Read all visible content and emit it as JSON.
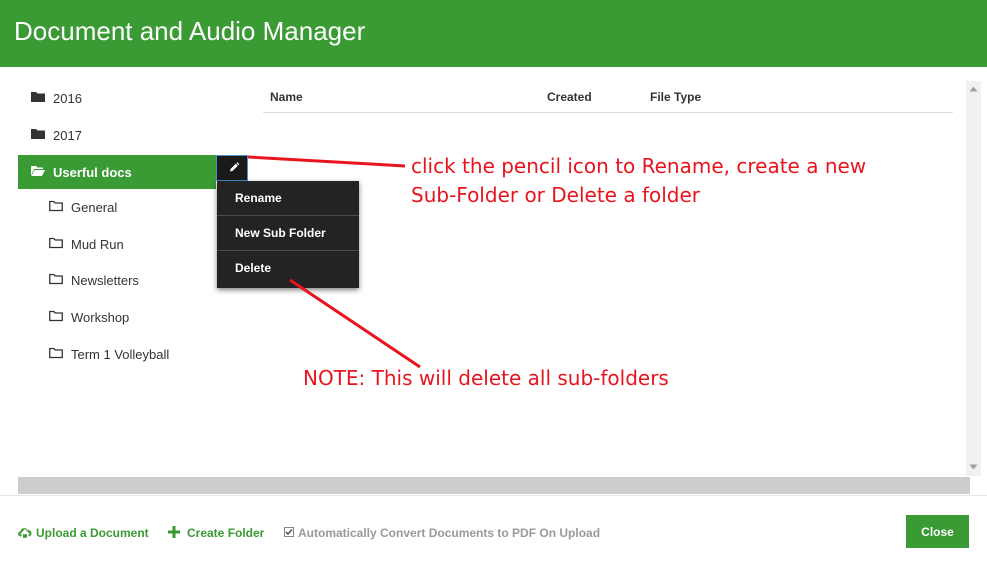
{
  "window": {
    "title": "Document and Audio Manager"
  },
  "folders": [
    {
      "label": "2016",
      "icon": "folder-icon"
    },
    {
      "label": "2017",
      "icon": "folder-icon"
    },
    {
      "label": "Userful docs",
      "icon": "folder-open-icon",
      "selected": true
    },
    {
      "label": "General",
      "icon": "folder-outline-icon"
    },
    {
      "label": "Mud Run",
      "icon": "folder-outline-icon"
    },
    {
      "label": "Newsletters",
      "icon": "folder-outline-icon"
    },
    {
      "label": "Workshop",
      "icon": "folder-outline-icon"
    },
    {
      "label": "Term 1 Volleyball",
      "icon": "folder-outline-icon"
    }
  ],
  "context_menu": {
    "trigger_icon": "pencil-icon",
    "items": [
      "Rename",
      "New Sub Folder",
      "Delete"
    ]
  },
  "table": {
    "columns": [
      "Name",
      "Created",
      "File Type"
    ]
  },
  "annotations": {
    "pencil_note_line1": "click the pencil icon to Rename, create a new",
    "pencil_note_line2": "Sub-Folder or Delete a folder",
    "delete_note": "NOTE: This will delete all sub-folders",
    "color": "#e8141e"
  },
  "footer": {
    "upload_label": "Upload a Document",
    "create_folder_label": "Create Folder",
    "auto_convert_label": "Automatically Convert Documents to PDF On Upload",
    "auto_convert_checked": true,
    "close_label": "Close"
  },
  "colors": {
    "accent": "#3a9a34",
    "menu_bg": "#232323"
  }
}
